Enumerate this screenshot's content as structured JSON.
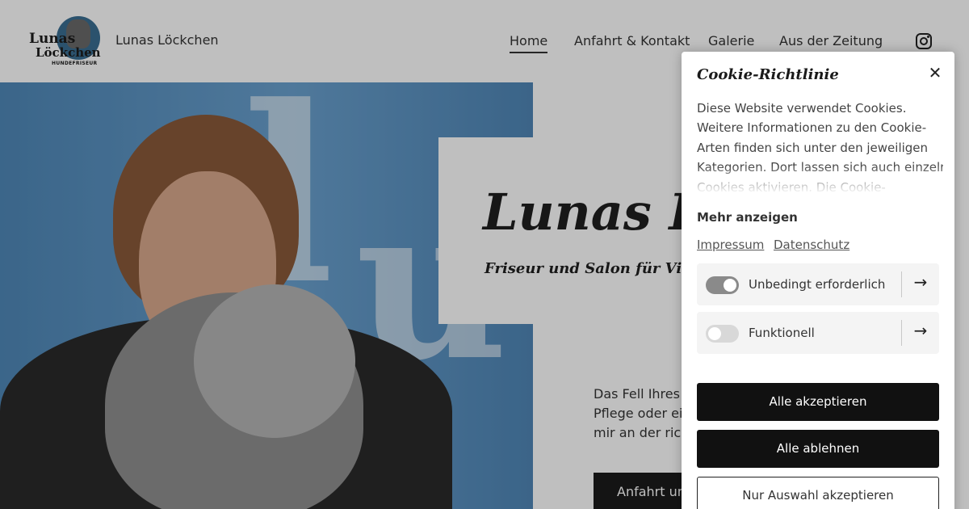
{
  "header": {
    "logo": {
      "line1": "Lunas",
      "line2": "Löckchen",
      "line3": "HUNDEFRISEUR"
    },
    "site_title": "Lunas Löckchen",
    "nav": [
      {
        "label": "Home",
        "active": true
      },
      {
        "label": "Anfahrt & Kontakt",
        "active": false
      },
      {
        "label": "Galerie",
        "active": false
      },
      {
        "label": "Aus der Zeitung",
        "active": false
      }
    ],
    "social_icon": "instagram-icon"
  },
  "hero": {
    "title": "Lunas Lö",
    "subtitle": "Friseur und Salon für Vierbeiner i",
    "text_lines": [
      "Das Fell Ihres H",
      "Pflege oder eine",
      "mir an der richt"
    ],
    "cta_label": "Anfahrt und"
  },
  "cookie": {
    "title": "Cookie-Richtlinie",
    "close_icon": "close-icon",
    "description_lines": [
      "Diese Website verwendet Cookies.",
      "Weitere Informationen zu den Cookie-",
      "Arten finden sich unter den jeweiligen",
      "Kategorien. Dort lassen sich auch einzelne",
      "Cookies aktivieren. Die Cookie-"
    ],
    "more_label": "Mehr anzeigen",
    "links": [
      "Impressum",
      "Datenschutz"
    ],
    "categories": [
      {
        "label": "Unbedingt erforderlich",
        "enabled": true
      },
      {
        "label": "Funktionell",
        "enabled": false
      }
    ],
    "buttons": {
      "accept_all": "Alle akzeptieren",
      "reject_all": "Alle ablehnen",
      "accept_selection": "Nur Auswahl akzeptieren"
    }
  },
  "colors": {
    "overlay": "#00000040",
    "hero_blue": "#5b93c2",
    "button_dark": "#111111"
  }
}
